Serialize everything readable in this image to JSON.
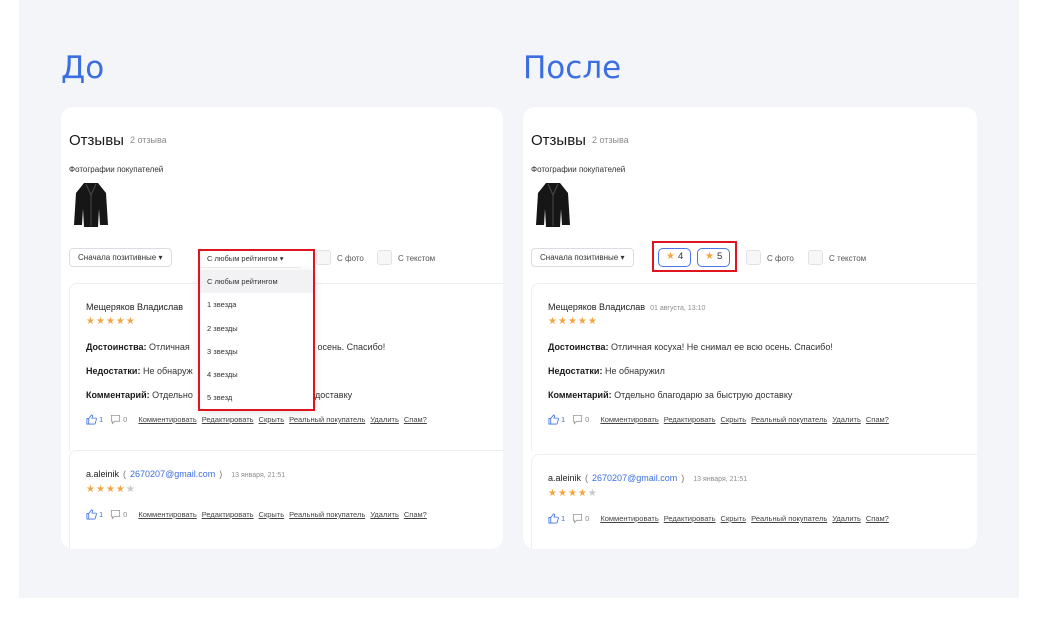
{
  "before": {
    "heading": "До",
    "title": "Отзывы",
    "count": "2 отзыва",
    "photos_label": "Фотографии покупателей",
    "sort_label": "Сначала позитивные",
    "rating_filter_label": "С любым рейтингом",
    "rating_options": [
      "С любым рейтингом",
      "1 звезда",
      "2 звезды",
      "3 звезды",
      "4 звезды",
      "5 звезд"
    ],
    "photo_filter_label": "С фото",
    "text_filter_label": "С текстом",
    "review1": {
      "name": "Мещеряков Владислав",
      "rating": 5,
      "pros_label": "Достоинства:",
      "pros_text": "Отличная",
      "pros_tail": "о осень. Спасибо!",
      "cons_label": "Недостатки:",
      "cons_text": "Не обнаруж",
      "comment_label": "Комментарий:",
      "comment_text": "Отдельно",
      "comment_tail": "доставку",
      "likes": "1",
      "dislikes": "0"
    },
    "review2": {
      "name": "a.aleinik",
      "email": "2670207@gmail.com",
      "date": "13 января, 21:51",
      "rating": 4,
      "likes": "1",
      "dislikes": "0"
    },
    "actions": [
      "Комментировать",
      "Редактировать",
      "Скрыть",
      "Реальный покупатель",
      "Удалить",
      "Спам?"
    ]
  },
  "after": {
    "heading": "После",
    "title": "Отзывы",
    "count": "2 отзыва",
    "photos_label": "Фотографии покупателей",
    "sort_label": "Сначала позитивные",
    "chip1": "4",
    "chip2": "5",
    "photo_filter_label": "С фото",
    "text_filter_label": "С текстом",
    "review1": {
      "name": "Мещеряков Владислав",
      "date": "01 августа, 13:10",
      "rating": 5,
      "pros_label": "Достоинства:",
      "pros_text": "Отличная косуха! Не снимал ее всю осень. Спасибо!",
      "cons_label": "Недостатки:",
      "cons_text": "Не обнаружил",
      "comment_label": "Комментарий:",
      "comment_text": "Отдельно благодарю за быструю доставку",
      "likes": "1",
      "dislikes": "0"
    },
    "review2": {
      "name": "a.aleinik",
      "email": "2670207@gmail.com",
      "date": "13 января, 21:51",
      "rating": 4,
      "likes": "1",
      "dislikes": "0"
    },
    "actions": [
      "Комментировать",
      "Редактировать",
      "Скрыть",
      "Реальный покупатель",
      "Удалить",
      "Спам?"
    ]
  },
  "colors": {
    "accent": "#3b6fe0",
    "star": "#f3a541",
    "highlight": "#e0141f"
  },
  "glyphs": {
    "star": "★",
    "caret": "▾",
    "paren_open": "(",
    "paren_close": ")"
  }
}
